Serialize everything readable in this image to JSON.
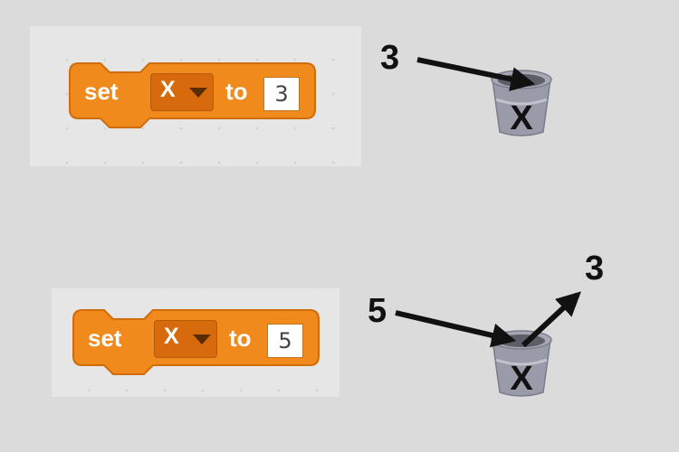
{
  "examples": [
    {
      "block": {
        "keyword_set": "set",
        "variable": "X",
        "keyword_to": "to",
        "value": "3"
      },
      "incoming_value": "3",
      "bucket_label": "X"
    },
    {
      "block": {
        "keyword_set": "set",
        "variable": "X",
        "keyword_to": "to",
        "value": "5"
      },
      "incoming_value": "5",
      "outgoing_value": "3",
      "bucket_label": "X"
    }
  ],
  "colors": {
    "block_orange": "#f08a1c",
    "block_dark": "#d66a0c",
    "background": "#dbdbdb",
    "bucket_gray": "#9a9ba9"
  },
  "icons": [
    "bucket-icon",
    "arrow-icon",
    "dropdown-caret-icon"
  ]
}
